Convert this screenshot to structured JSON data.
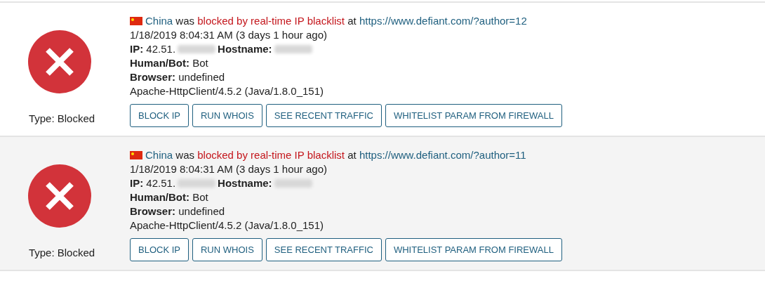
{
  "events": [
    {
      "kind": "blocked",
      "type": "Type: Blocked",
      "country": "China",
      "verb": "was",
      "action": "blocked by real-time IP blacklist",
      "at": "at",
      "url": "https://www.defiant.com/?author=12",
      "lines": [
        {
          "kind": "text",
          "parts": [
            {
              "kind": "text",
              "text": "1/18/2019 8:04:31 AM (3 days 1 hour ago)"
            }
          ]
        },
        {
          "kind": "mixed",
          "parts": [
            {
              "kind": "text",
              "text": "**IP:** 42.51."
            },
            {
              "kind": "redacted"
            },
            {
              "kind": "text",
              "text": "**Hostname:**"
            },
            {
              "kind": "redacted"
            }
          ]
        },
        {
          "kind": "text",
          "parts": [
            {
              "kind": "text",
              "text": "**Human/Bot:** Bot"
            }
          ]
        },
        {
          "kind": "text",
          "parts": [
            {
              "kind": "text",
              "text": "**Browser:** undefined"
            }
          ]
        },
        {
          "kind": "text",
          "parts": [
            {
              "kind": "text",
              "text": "Apache-HttpClient/4.5.2 (Java/1.8.0_151)"
            }
          ]
        }
      ],
      "buttons": [
        "BLOCK IP",
        "RUN WHOIS",
        "SEE RECENT TRAFFIC",
        "WHITELIST PARAM FROM FIREWALL"
      ]
    },
    {
      "kind": "blocked",
      "type": "Type: Blocked",
      "country": "China",
      "verb": "was",
      "action": "blocked by real-time IP blacklist",
      "at": "at",
      "url": "https://www.defiant.com/?author=11",
      "lines": [
        {
          "kind": "text",
          "parts": [
            {
              "kind": "text",
              "text": "1/18/2019 8:04:31 AM (3 days 1 hour ago)"
            }
          ]
        },
        {
          "kind": "mixed",
          "parts": [
            {
              "kind": "text",
              "text": "**IP:** 42.51."
            },
            {
              "kind": "redacted"
            },
            {
              "kind": "text",
              "text": "**Hostname:**"
            },
            {
              "kind": "redacted"
            }
          ]
        },
        {
          "kind": "text",
          "parts": [
            {
              "kind": "text",
              "text": "**Human/Bot:** Bot"
            }
          ]
        },
        {
          "kind": "text",
          "parts": [
            {
              "kind": "text",
              "text": "**Browser:** undefined"
            }
          ]
        },
        {
          "kind": "text",
          "parts": [
            {
              "kind": "text",
              "text": "Apache-HttpClient/4.5.2 (Java/1.8.0_151)"
            }
          ]
        }
      ],
      "buttons": [
        "BLOCK IP",
        "RUN WHOIS",
        "SEE RECENT TRAFFIC",
        "WHITELIST PARAM FROM FIREWALL"
      ]
    }
  ]
}
